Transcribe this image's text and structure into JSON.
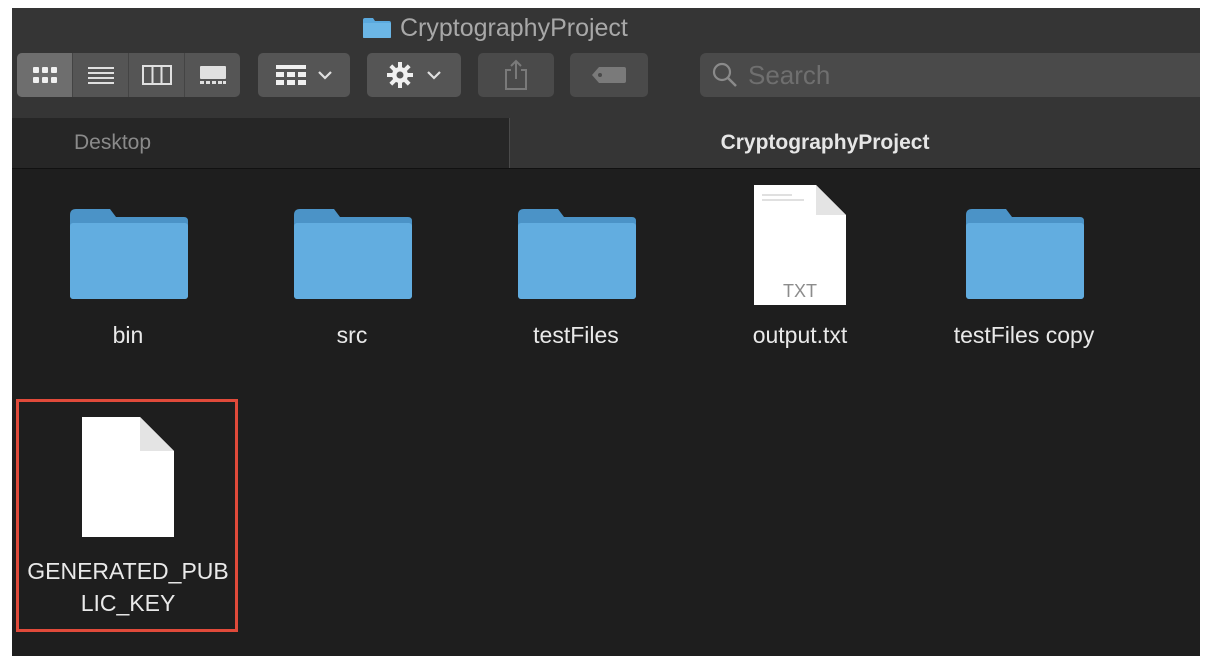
{
  "window": {
    "title": "CryptographyProject"
  },
  "toolbar": {
    "view_modes": [
      {
        "name": "icon-view",
        "active": true
      },
      {
        "name": "list-view",
        "active": false
      },
      {
        "name": "column-view",
        "active": false
      },
      {
        "name": "gallery-view",
        "active": false
      }
    ],
    "search_placeholder": "Search"
  },
  "pathbar": {
    "items": [
      {
        "label": "Desktop",
        "active": false
      },
      {
        "label": "CryptographyProject",
        "active": true
      }
    ]
  },
  "files": [
    {
      "name": "bin",
      "kind": "folder"
    },
    {
      "name": "src",
      "kind": "folder"
    },
    {
      "name": "testFiles",
      "kind": "folder"
    },
    {
      "name": "output.txt",
      "kind": "text-document",
      "badge": "TXT"
    },
    {
      "name": "testFiles copy",
      "kind": "folder"
    },
    {
      "name_line1": "GENERATED_PUB",
      "name_line2": "LIC_KEY",
      "kind": "document",
      "highlighted": true
    }
  ],
  "colors": {
    "window_bg": "#1e1e1e",
    "folder_blue": "#5aa9de",
    "highlight_border": "#e04a3a"
  }
}
